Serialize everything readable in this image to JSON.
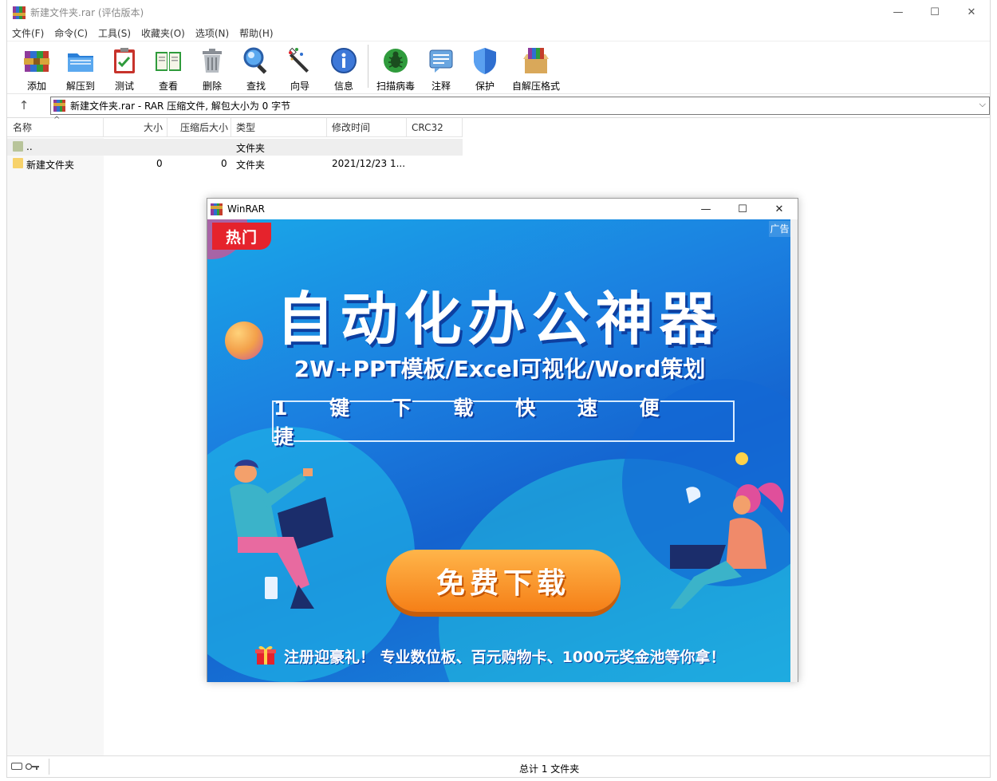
{
  "window": {
    "title": "新建文件夹.rar (评估版本)",
    "controls": {
      "minimize": "—",
      "maximize": "☐",
      "close": "✕"
    }
  },
  "menu": [
    "文件(F)",
    "命令(C)",
    "工具(S)",
    "收藏夹(O)",
    "选项(N)",
    "帮助(H)"
  ],
  "toolbar": {
    "add": "添加",
    "extract": "解压到",
    "test": "测试",
    "view": "查看",
    "delete": "删除",
    "find": "查找",
    "wizard": "向导",
    "info": "信息",
    "scan": "扫描病毒",
    "comment": "注释",
    "protect": "保护",
    "sfx": "自解压格式"
  },
  "address": {
    "up": "↑",
    "text": "新建文件夹.rar - RAR 压缩文件, 解包大小为 0 字节",
    "chevron": "⌵"
  },
  "columns": {
    "sort_caret": "^",
    "name": "名称",
    "size": "大小",
    "packed": "压缩后大小",
    "type": "类型",
    "modified": "修改时间",
    "crc": "CRC32"
  },
  "rows": [
    {
      "name": "..",
      "size": "",
      "packed": "",
      "type": "文件夹",
      "modified": "",
      "crc": ""
    },
    {
      "name": "新建文件夹",
      "size": "0",
      "packed": "0",
      "type": "文件夹",
      "modified": "2021/12/23 1...",
      "crc": ""
    }
  ],
  "status": {
    "text": "总计 1 文件夹"
  },
  "popup": {
    "title": "WinRAR",
    "controls": {
      "minimize": "—",
      "maximize": "☐",
      "close": "✕"
    },
    "ad": {
      "hot_tag": "热门",
      "ad_label": "广告",
      "headline": "自动化办公神器",
      "subheadline": "2W+PPT模板/Excel可视化/Word策划",
      "box_text": "1 键 下 载   快 速 便 捷",
      "button": "免费下载",
      "footer": "注册迎豪礼！ 专业数位板、百元购物卡、1000元奖金池等你拿！"
    }
  },
  "colors": {
    "accent_orange": "#f57f17",
    "ad_blue": "#1b7fe0",
    "hot_red": "#e5232c",
    "folder_yellow": "#f7d26b"
  }
}
